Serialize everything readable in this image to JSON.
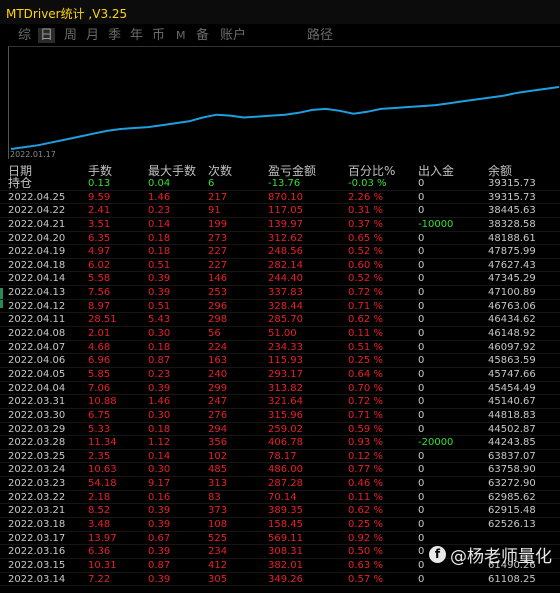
{
  "window": {
    "title": "MTDriver统计 ,V3.25"
  },
  "tabs": [
    {
      "label": "综",
      "active": false
    },
    {
      "label": "日",
      "active": true
    },
    {
      "label": "周",
      "active": false
    },
    {
      "label": "月",
      "active": false
    },
    {
      "label": "季",
      "active": false
    },
    {
      "label": "年",
      "active": false
    },
    {
      "label": "币",
      "active": false
    },
    {
      "label": "M",
      "active": false
    },
    {
      "label": "备",
      "active": false
    },
    {
      "label": "账户",
      "active": false
    },
    {
      "label": "路径",
      "active": false
    }
  ],
  "chart": {
    "start_date_label": "2022.01.17",
    "line_color": "#1e9fe0",
    "equity_values": [
      0,
      2,
      4,
      7,
      10,
      13,
      16,
      19,
      21,
      22,
      23,
      25,
      27,
      29,
      33,
      36,
      35,
      33,
      34,
      35,
      36,
      38,
      41,
      42,
      40,
      37,
      39,
      42,
      43,
      44,
      45,
      46,
      48,
      50,
      52,
      54,
      56,
      59,
      61,
      63,
      65
    ]
  },
  "table": {
    "headers": [
      "日期",
      "手数",
      "最大手数",
      "次数",
      "盈亏金额",
      "百分比%",
      "出入金",
      "余额"
    ],
    "holding": {
      "label": "持仓",
      "lots": "0.13",
      "max_lots": "0.04",
      "count": "6",
      "pnl": "-13.76",
      "pct": "-0.03 %",
      "flow": "0",
      "balance": "39315.73"
    },
    "rows": [
      {
        "date": "2022.04.25",
        "lots": "9.59",
        "max_lots": "1.46",
        "count": "217",
        "pnl": "870.10",
        "pct": "2.26 %",
        "flow": "0",
        "balance": "39315.73"
      },
      {
        "date": "2022.04.22",
        "lots": "2.41",
        "max_lots": "0.23",
        "count": "91",
        "pnl": "117.05",
        "pct": "0.31 %",
        "flow": "0",
        "balance": "38445.63"
      },
      {
        "date": "2022.04.21",
        "lots": "3.51",
        "max_lots": "0.14",
        "count": "199",
        "pnl": "139.97",
        "pct": "0.37 %",
        "flow": "-10000",
        "balance": "38328.58"
      },
      {
        "date": "2022.04.20",
        "lots": "6.35",
        "max_lots": "0.18",
        "count": "273",
        "pnl": "312.62",
        "pct": "0.65 %",
        "flow": "0",
        "balance": "48188.61"
      },
      {
        "date": "2022.04.19",
        "lots": "4.97",
        "max_lots": "0.18",
        "count": "227",
        "pnl": "248.56",
        "pct": "0.52 %",
        "flow": "0",
        "balance": "47875.99"
      },
      {
        "date": "2022.04.18",
        "lots": "6.02",
        "max_lots": "0.51",
        "count": "227",
        "pnl": "282.14",
        "pct": "0.60 %",
        "flow": "0",
        "balance": "47627.43"
      },
      {
        "date": "2022.04.14",
        "lots": "5.58",
        "max_lots": "0.39",
        "count": "146",
        "pnl": "244.40",
        "pct": "0.52 %",
        "flow": "0",
        "balance": "47345.29"
      },
      {
        "date": "2022.04.13",
        "lots": "7.56",
        "max_lots": "0.39",
        "count": "253",
        "pnl": "337.83",
        "pct": "0.72 %",
        "flow": "0",
        "balance": "47100.89"
      },
      {
        "date": "2022.04.12",
        "lots": "8.97",
        "max_lots": "0.51",
        "count": "296",
        "pnl": "328.44",
        "pct": "0.71 %",
        "flow": "0",
        "balance": "46763.06"
      },
      {
        "date": "2022.04.11",
        "lots": "28.51",
        "max_lots": "5.43",
        "count": "298",
        "pnl": "285.70",
        "pct": "0.62 %",
        "flow": "0",
        "balance": "46434.62"
      },
      {
        "date": "2022.04.08",
        "lots": "2.01",
        "max_lots": "0.30",
        "count": "56",
        "pnl": "51.00",
        "pct": "0.11 %",
        "flow": "0",
        "balance": "46148.92"
      },
      {
        "date": "2022.04.07",
        "lots": "4.68",
        "max_lots": "0.18",
        "count": "224",
        "pnl": "234.33",
        "pct": "0.51 %",
        "flow": "0",
        "balance": "46097.92"
      },
      {
        "date": "2022.04.06",
        "lots": "6.96",
        "max_lots": "0.87",
        "count": "163",
        "pnl": "115.93",
        "pct": "0.25 %",
        "flow": "0",
        "balance": "45863.59"
      },
      {
        "date": "2022.04.05",
        "lots": "5.85",
        "max_lots": "0.23",
        "count": "240",
        "pnl": "293.17",
        "pct": "0.64 %",
        "flow": "0",
        "balance": "45747.66"
      },
      {
        "date": "2022.04.04",
        "lots": "7.06",
        "max_lots": "0.39",
        "count": "299",
        "pnl": "313.82",
        "pct": "0.70 %",
        "flow": "0",
        "balance": "45454.49"
      },
      {
        "date": "2022.03.31",
        "lots": "10.88",
        "max_lots": "1.46",
        "count": "247",
        "pnl": "321.64",
        "pct": "0.72 %",
        "flow": "0",
        "balance": "45140.67"
      },
      {
        "date": "2022.03.30",
        "lots": "6.75",
        "max_lots": "0.30",
        "count": "276",
        "pnl": "315.96",
        "pct": "0.71 %",
        "flow": "0",
        "balance": "44818.83"
      },
      {
        "date": "2022.03.29",
        "lots": "5.33",
        "max_lots": "0.18",
        "count": "294",
        "pnl": "259.02",
        "pct": "0.59 %",
        "flow": "0",
        "balance": "44502.87"
      },
      {
        "date": "2022.03.28",
        "lots": "11.34",
        "max_lots": "1.12",
        "count": "356",
        "pnl": "406.78",
        "pct": "0.93 %",
        "flow": "-20000",
        "balance": "44243.85"
      },
      {
        "date": "2022.03.25",
        "lots": "2.35",
        "max_lots": "0.14",
        "count": "102",
        "pnl": "78.17",
        "pct": "0.12 %",
        "flow": "0",
        "balance": "63837.07"
      },
      {
        "date": "2022.03.24",
        "lots": "10.63",
        "max_lots": "0.30",
        "count": "485",
        "pnl": "486.00",
        "pct": "0.77 %",
        "flow": "0",
        "balance": "63758.90"
      },
      {
        "date": "2022.03.23",
        "lots": "54.18",
        "max_lots": "9.17",
        "count": "313",
        "pnl": "287.28",
        "pct": "0.46 %",
        "flow": "0",
        "balance": "63272.90"
      },
      {
        "date": "2022.03.22",
        "lots": "2.18",
        "max_lots": "0.16",
        "count": "83",
        "pnl": "70.14",
        "pct": "0.11 %",
        "flow": "0",
        "balance": "62985.62"
      },
      {
        "date": "2022.03.21",
        "lots": "8.52",
        "max_lots": "0.39",
        "count": "373",
        "pnl": "389.35",
        "pct": "0.62 %",
        "flow": "0",
        "balance": "62915.48"
      },
      {
        "date": "2022.03.18",
        "lots": "3.48",
        "max_lots": "0.39",
        "count": "108",
        "pnl": "158.45",
        "pct": "0.25 %",
        "flow": "0",
        "balance": "62526.13"
      },
      {
        "date": "2022.03.17",
        "lots": "13.97",
        "max_lots": "0.67",
        "count": "525",
        "pnl": "569.11",
        "pct": "0.92 %",
        "flow": "0",
        "balance": ""
      },
      {
        "date": "2022.03.16",
        "lots": "6.36",
        "max_lots": "0.39",
        "count": "234",
        "pnl": "308.31",
        "pct": "0.50 %",
        "flow": "0",
        "balance": ""
      },
      {
        "date": "2022.03.15",
        "lots": "10.31",
        "max_lots": "0.87",
        "count": "412",
        "pnl": "382.01",
        "pct": "0.63 %",
        "flow": "0",
        "balance": "61490.26"
      },
      {
        "date": "2022.03.14",
        "lots": "7.22",
        "max_lots": "0.39",
        "count": "305",
        "pnl": "349.26",
        "pct": "0.57 %",
        "flow": "0",
        "balance": "61108.25"
      }
    ]
  },
  "watermark": {
    "logo_text": "f",
    "text": "@杨老师量化"
  }
}
